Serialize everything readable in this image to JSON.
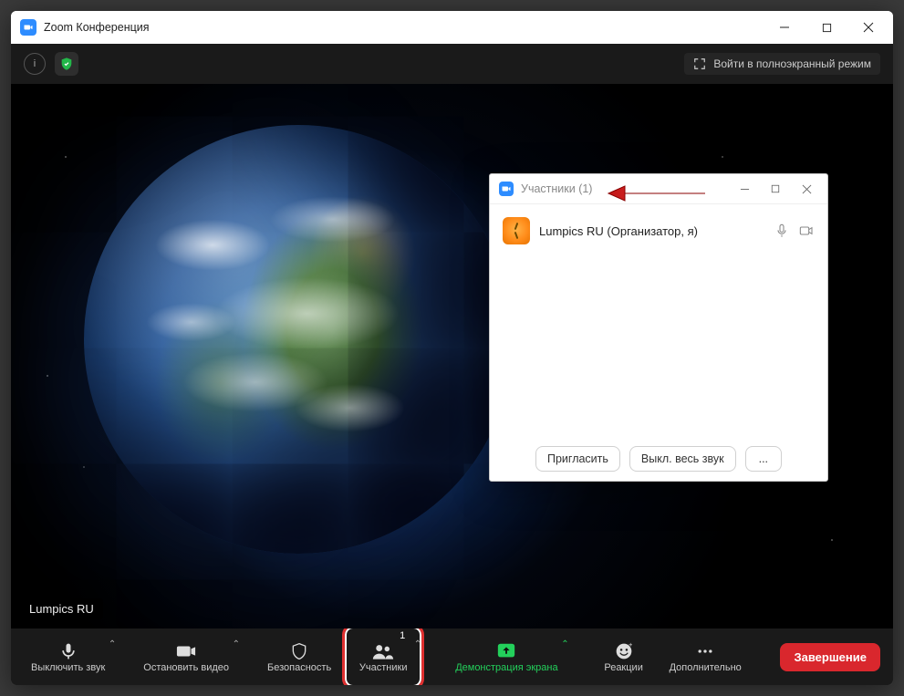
{
  "window": {
    "title": "Zoom Конференция"
  },
  "topbar": {
    "fullscreen_label": "Войти в полноэкранный режим"
  },
  "video": {
    "speaker_name": "Lumpics RU"
  },
  "toolbar": {
    "mute_label": "Выключить звук",
    "video_label": "Остановить видео",
    "security_label": "Безопасность",
    "participants_label": "Участники",
    "participants_count": "1",
    "share_label": "Демонстрация экрана",
    "reactions_label": "Реакции",
    "more_label": "Дополнительно",
    "end_label": "Завершение"
  },
  "participants_window": {
    "title": "Участники (1)",
    "entries": [
      {
        "name": "Lumpics RU (Организатор, я)"
      }
    ],
    "invite_label": "Пригласить",
    "mute_all_label": "Выкл. весь звук",
    "more_label": "..."
  }
}
